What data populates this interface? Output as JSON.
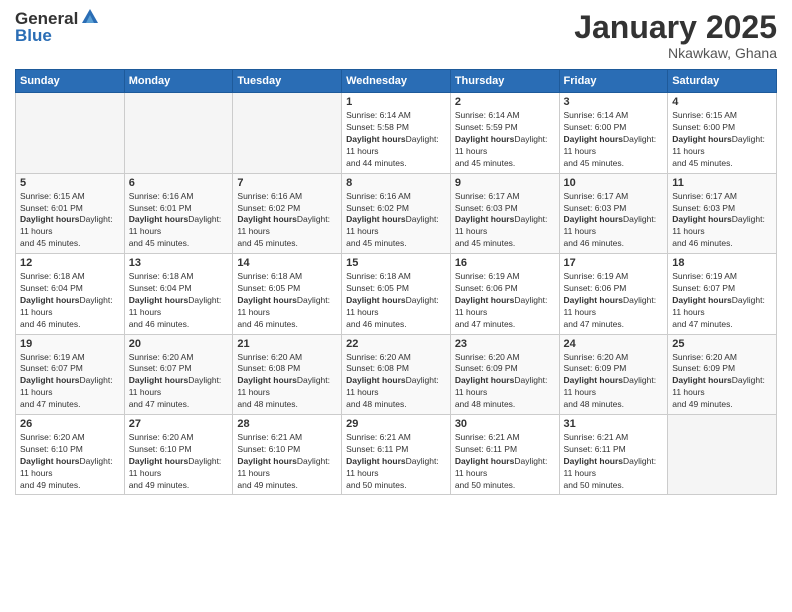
{
  "logo": {
    "general": "General",
    "blue": "Blue"
  },
  "header": {
    "title": "January 2025",
    "subtitle": "Nkawkaw, Ghana"
  },
  "weekdays": [
    "Sunday",
    "Monday",
    "Tuesday",
    "Wednesday",
    "Thursday",
    "Friday",
    "Saturday"
  ],
  "weeks": [
    [
      {
        "day": "",
        "info": ""
      },
      {
        "day": "",
        "info": ""
      },
      {
        "day": "",
        "info": ""
      },
      {
        "day": "1",
        "info": "Sunrise: 6:14 AM\nSunset: 5:58 PM\nDaylight: 11 hours\nand 44 minutes."
      },
      {
        "day": "2",
        "info": "Sunrise: 6:14 AM\nSunset: 5:59 PM\nDaylight: 11 hours\nand 45 minutes."
      },
      {
        "day": "3",
        "info": "Sunrise: 6:14 AM\nSunset: 6:00 PM\nDaylight: 11 hours\nand 45 minutes."
      },
      {
        "day": "4",
        "info": "Sunrise: 6:15 AM\nSunset: 6:00 PM\nDaylight: 11 hours\nand 45 minutes."
      }
    ],
    [
      {
        "day": "5",
        "info": "Sunrise: 6:15 AM\nSunset: 6:01 PM\nDaylight: 11 hours\nand 45 minutes."
      },
      {
        "day": "6",
        "info": "Sunrise: 6:16 AM\nSunset: 6:01 PM\nDaylight: 11 hours\nand 45 minutes."
      },
      {
        "day": "7",
        "info": "Sunrise: 6:16 AM\nSunset: 6:02 PM\nDaylight: 11 hours\nand 45 minutes."
      },
      {
        "day": "8",
        "info": "Sunrise: 6:16 AM\nSunset: 6:02 PM\nDaylight: 11 hours\nand 45 minutes."
      },
      {
        "day": "9",
        "info": "Sunrise: 6:17 AM\nSunset: 6:03 PM\nDaylight: 11 hours\nand 45 minutes."
      },
      {
        "day": "10",
        "info": "Sunrise: 6:17 AM\nSunset: 6:03 PM\nDaylight: 11 hours\nand 46 minutes."
      },
      {
        "day": "11",
        "info": "Sunrise: 6:17 AM\nSunset: 6:03 PM\nDaylight: 11 hours\nand 46 minutes."
      }
    ],
    [
      {
        "day": "12",
        "info": "Sunrise: 6:18 AM\nSunset: 6:04 PM\nDaylight: 11 hours\nand 46 minutes."
      },
      {
        "day": "13",
        "info": "Sunrise: 6:18 AM\nSunset: 6:04 PM\nDaylight: 11 hours\nand 46 minutes."
      },
      {
        "day": "14",
        "info": "Sunrise: 6:18 AM\nSunset: 6:05 PM\nDaylight: 11 hours\nand 46 minutes."
      },
      {
        "day": "15",
        "info": "Sunrise: 6:18 AM\nSunset: 6:05 PM\nDaylight: 11 hours\nand 46 minutes."
      },
      {
        "day": "16",
        "info": "Sunrise: 6:19 AM\nSunset: 6:06 PM\nDaylight: 11 hours\nand 47 minutes."
      },
      {
        "day": "17",
        "info": "Sunrise: 6:19 AM\nSunset: 6:06 PM\nDaylight: 11 hours\nand 47 minutes."
      },
      {
        "day": "18",
        "info": "Sunrise: 6:19 AM\nSunset: 6:07 PM\nDaylight: 11 hours\nand 47 minutes."
      }
    ],
    [
      {
        "day": "19",
        "info": "Sunrise: 6:19 AM\nSunset: 6:07 PM\nDaylight: 11 hours\nand 47 minutes."
      },
      {
        "day": "20",
        "info": "Sunrise: 6:20 AM\nSunset: 6:07 PM\nDaylight: 11 hours\nand 47 minutes."
      },
      {
        "day": "21",
        "info": "Sunrise: 6:20 AM\nSunset: 6:08 PM\nDaylight: 11 hours\nand 48 minutes."
      },
      {
        "day": "22",
        "info": "Sunrise: 6:20 AM\nSunset: 6:08 PM\nDaylight: 11 hours\nand 48 minutes."
      },
      {
        "day": "23",
        "info": "Sunrise: 6:20 AM\nSunset: 6:09 PM\nDaylight: 11 hours\nand 48 minutes."
      },
      {
        "day": "24",
        "info": "Sunrise: 6:20 AM\nSunset: 6:09 PM\nDaylight: 11 hours\nand 48 minutes."
      },
      {
        "day": "25",
        "info": "Sunrise: 6:20 AM\nSunset: 6:09 PM\nDaylight: 11 hours\nand 49 minutes."
      }
    ],
    [
      {
        "day": "26",
        "info": "Sunrise: 6:20 AM\nSunset: 6:10 PM\nDaylight: 11 hours\nand 49 minutes."
      },
      {
        "day": "27",
        "info": "Sunrise: 6:20 AM\nSunset: 6:10 PM\nDaylight: 11 hours\nand 49 minutes."
      },
      {
        "day": "28",
        "info": "Sunrise: 6:21 AM\nSunset: 6:10 PM\nDaylight: 11 hours\nand 49 minutes."
      },
      {
        "day": "29",
        "info": "Sunrise: 6:21 AM\nSunset: 6:11 PM\nDaylight: 11 hours\nand 50 minutes."
      },
      {
        "day": "30",
        "info": "Sunrise: 6:21 AM\nSunset: 6:11 PM\nDaylight: 11 hours\nand 50 minutes."
      },
      {
        "day": "31",
        "info": "Sunrise: 6:21 AM\nSunset: 6:11 PM\nDaylight: 11 hours\nand 50 minutes."
      },
      {
        "day": "",
        "info": ""
      }
    ]
  ]
}
